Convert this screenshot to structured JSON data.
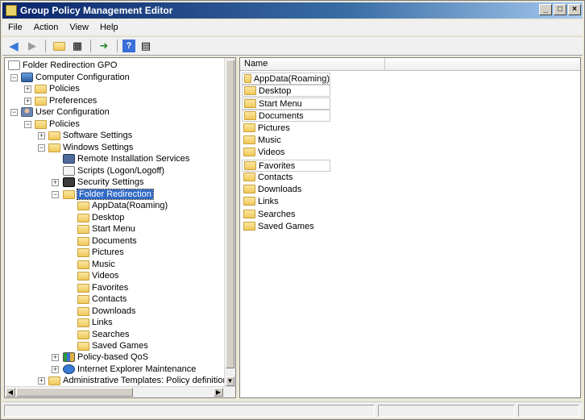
{
  "window": {
    "title": "Group Policy Management Editor"
  },
  "menu": [
    "File",
    "Action",
    "View",
    "Help"
  ],
  "tree": {
    "root": "Folder Redirection GPO",
    "computer_configuration": "Computer Configuration",
    "cc_policies": "Policies",
    "cc_preferences": "Preferences",
    "user_configuration": "User Configuration",
    "uc_policies": "Policies",
    "software_settings": "Software Settings",
    "windows_settings": "Windows Settings",
    "remote_installation_services": "Remote Installation Services",
    "scripts": "Scripts (Logon/Logoff)",
    "security_settings": "Security Settings",
    "folder_redirection": "Folder Redirection",
    "folders": [
      "AppData(Roaming)",
      "Desktop",
      "Start Menu",
      "Documents",
      "Pictures",
      "Music",
      "Videos",
      "Favorites",
      "Contacts",
      "Downloads",
      "Links",
      "Searches",
      "Saved Games"
    ],
    "policy_based_qos": "Policy-based QoS",
    "ie_maintenance": "Internet Explorer Maintenance",
    "admin_templates": "Administrative Templates: Policy definitions (A"
  },
  "list": {
    "header_name": "Name",
    "items": [
      "AppData(Roaming)",
      "Desktop",
      "Start Menu",
      "Documents",
      "Pictures",
      "Music",
      "Videos",
      "Favorites",
      "Contacts",
      "Downloads",
      "Links",
      "Searches",
      "Saved Games"
    ]
  },
  "icons": {
    "back": "back-arrow-icon",
    "forward": "forward-arrow-icon",
    "up": "up-folder-icon",
    "show-hide": "show-hide-tree-icon",
    "export": "export-list-icon",
    "help": "help-icon",
    "properties": "properties-icon"
  }
}
